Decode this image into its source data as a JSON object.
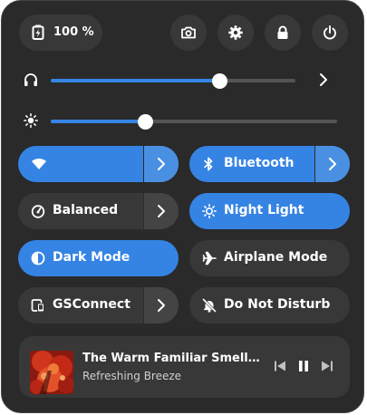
{
  "battery": {
    "percent_label": "100 %",
    "icon": "battery-charging-icon"
  },
  "header_buttons": [
    {
      "name": "screenshot",
      "icon": "camera-icon"
    },
    {
      "name": "settings",
      "icon": "gear-icon"
    },
    {
      "name": "lock",
      "icon": "lock-icon"
    },
    {
      "name": "power",
      "icon": "power-icon"
    }
  ],
  "sliders": {
    "volume": {
      "icon": "headphones-icon",
      "value": 0.69,
      "has_menu_arrow": true
    },
    "brightness": {
      "icon": "brightness-icon",
      "value": 0.33
    }
  },
  "tiles": {
    "wifi": {
      "label": "",
      "active": true,
      "icon": "wifi-icon"
    },
    "bluetooth": {
      "label": "Bluetooth",
      "active": true,
      "icon": "bluetooth-icon"
    },
    "power_mode": {
      "label": "Balanced",
      "active": false,
      "icon": "power-mode-icon"
    },
    "night_light": {
      "label": "Night Light",
      "active": true,
      "icon": "night-light-icon"
    },
    "dark_mode": {
      "label": "Dark Mode",
      "active": true,
      "icon": "dark-mode-icon"
    },
    "airplane_mode": {
      "label": "Airplane Mode",
      "active": false,
      "icon": "airplane-icon"
    },
    "gsconnect": {
      "label": "GSConnect",
      "active": false,
      "icon": "phone-icon"
    },
    "do_not_disturb": {
      "label": "Do Not Disturb",
      "active": false,
      "icon": "bell-off-icon"
    }
  },
  "media": {
    "title": "The Warm Familiar Smell of S…",
    "artist": "Refreshing Breeze",
    "controls": [
      "previous",
      "pause",
      "next"
    ]
  },
  "colors": {
    "panel": "#2a2a2a",
    "tile": "#383838",
    "accent": "#3584e4"
  }
}
